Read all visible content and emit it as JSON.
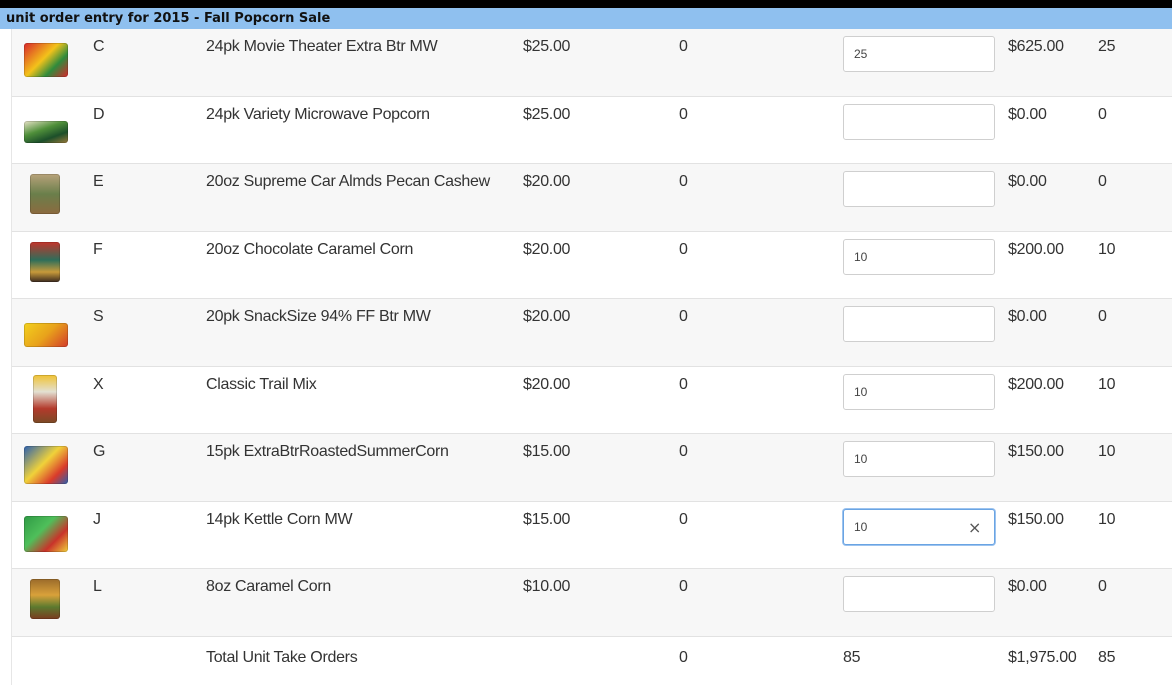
{
  "header": {
    "title": "unit order entry for 2015 - Fall Popcorn Sale"
  },
  "rows": [
    {
      "code": "C",
      "name": "24pk Movie Theater Extra Btr MW",
      "price": "$25.00",
      "zero": "0",
      "input": "25",
      "subtotal": "$625.00",
      "qty": "25",
      "thumb": "movie-theater-box-image"
    },
    {
      "code": "D",
      "name": "24pk Variety Microwave Popcorn",
      "price": "$25.00",
      "zero": "0",
      "input": "",
      "subtotal": "$0.00",
      "qty": "0",
      "thumb": "variety-box-image"
    },
    {
      "code": "E",
      "name": "20oz Supreme Car Almds Pecan Cashew",
      "price": "$20.00",
      "zero": "0",
      "input": "",
      "subtotal": "$0.00",
      "qty": "0",
      "thumb": "supreme-tin-image"
    },
    {
      "code": "F",
      "name": "20oz Chocolate Caramel Corn",
      "price": "$20.00",
      "zero": "0",
      "input": "10",
      "subtotal": "$200.00",
      "qty": "10",
      "thumb": "chocolate-caramel-tin-image"
    },
    {
      "code": "S",
      "name": "20pk SnackSize 94% FF Btr MW",
      "price": "$20.00",
      "zero": "0",
      "input": "",
      "subtotal": "$0.00",
      "qty": "0",
      "thumb": "snacksize-box-image"
    },
    {
      "code": "X",
      "name": "Classic Trail Mix",
      "price": "$20.00",
      "zero": "0",
      "input": "10",
      "subtotal": "$200.00",
      "qty": "10",
      "thumb": "trail-mix-bag-image"
    },
    {
      "code": "G",
      "name": "15pk ExtraBtrRoastedSummerCorn",
      "price": "$15.00",
      "zero": "0",
      "input": "10",
      "subtotal": "$150.00",
      "qty": "10",
      "thumb": "summer-corn-box-image"
    },
    {
      "code": "J",
      "name": "14pk Kettle Corn MW",
      "price": "$15.00",
      "zero": "0",
      "input": "10",
      "subtotal": "$150.00",
      "qty": "10",
      "thumb": "kettle-corn-box-image"
    },
    {
      "code": "L",
      "name": "8oz Caramel Corn",
      "price": "$10.00",
      "zero": "0",
      "input": "",
      "subtotal": "$0.00",
      "qty": "0",
      "thumb": "caramel-corn-tin-image"
    }
  ],
  "total": {
    "label": "Total Unit Take Orders",
    "zero": "0",
    "units": "85",
    "amount": "$1,975.00",
    "qty": "85"
  },
  "clear_icon": "×",
  "colors": {
    "title_bar": "#8fc0ef",
    "row_alt": "#f7f7f7"
  }
}
